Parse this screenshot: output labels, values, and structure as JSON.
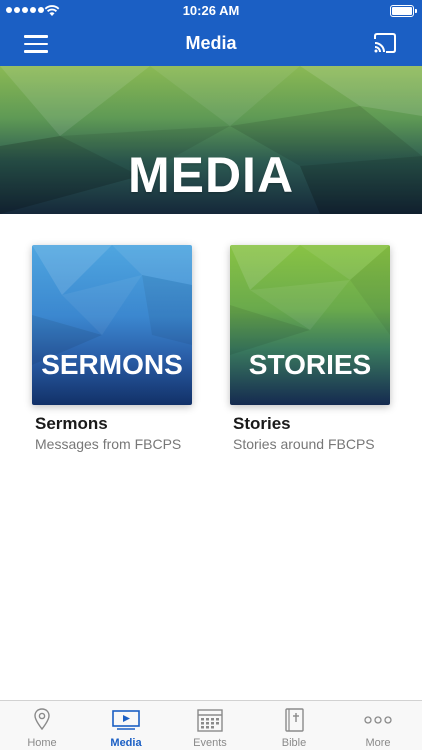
{
  "status_bar": {
    "time": "10:26 AM"
  },
  "nav_bar": {
    "title": "Media"
  },
  "hero": {
    "title": "MEDIA"
  },
  "cards": [
    {
      "thumb_label": "SERMONS",
      "title": "Sermons",
      "subtitle": "Messages from FBCPS"
    },
    {
      "thumb_label": "STORIES",
      "title": "Stories",
      "subtitle": "Stories around FBCPS"
    }
  ],
  "tab_bar": {
    "tabs": [
      {
        "label": "Home",
        "icon": "map-pin-icon",
        "active": false
      },
      {
        "label": "Media",
        "icon": "play-screen-icon",
        "active": true
      },
      {
        "label": "Events",
        "icon": "calendar-icon",
        "active": false
      },
      {
        "label": "Bible",
        "icon": "bible-icon",
        "active": false
      },
      {
        "label": "More",
        "icon": "more-dots-icon",
        "active": false
      }
    ]
  },
  "colors": {
    "brand_blue": "#1b5fc4",
    "tab_inactive": "#8a8a8a",
    "subtitle_gray": "#777777"
  }
}
